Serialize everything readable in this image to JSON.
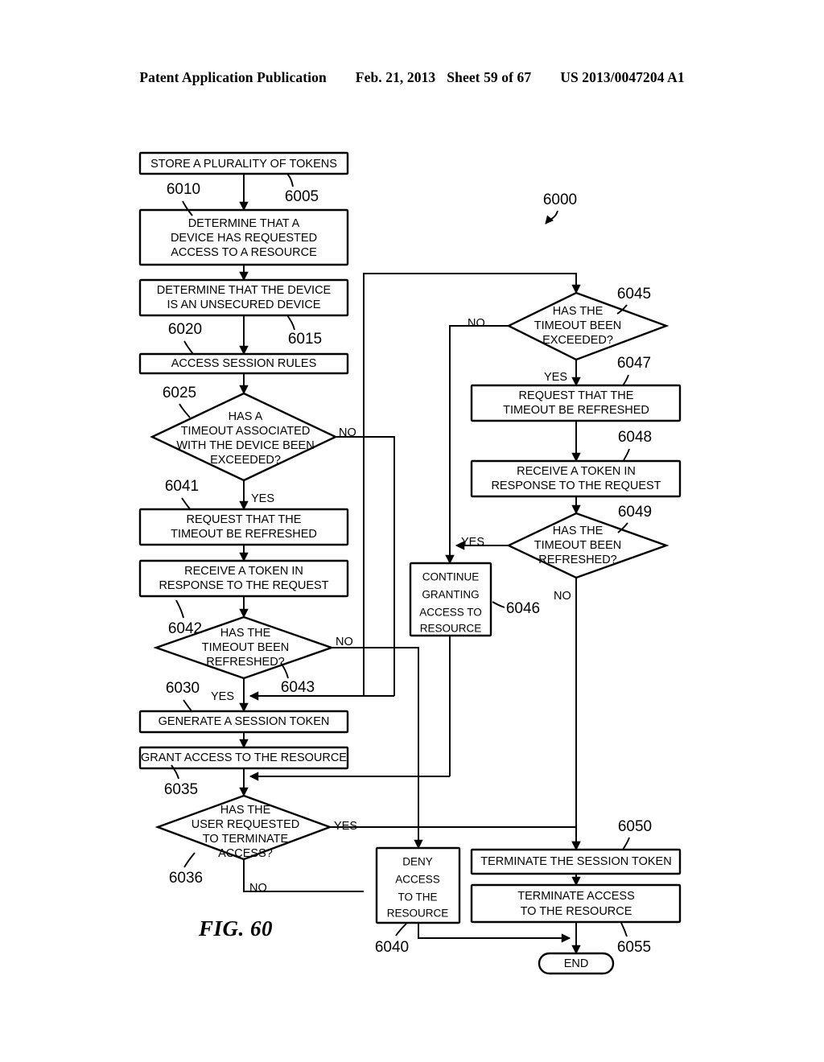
{
  "header": {
    "publication": "Patent Application Publication",
    "date": "Feb. 21, 2013",
    "sheet": "Sheet 59 of 67",
    "docnum": "US 2013/0047204 A1"
  },
  "figure": {
    "caption": "FIG. 60",
    "diagram_ref": "6000"
  },
  "flowchart": {
    "type": "flowchart",
    "nodes": [
      {
        "id": "6005",
        "ref": "6005",
        "shape": "process",
        "lines": [
          "STORE A PLURALITY OF TOKENS"
        ]
      },
      {
        "id": "6010",
        "ref": "6010",
        "shape": "process",
        "lines": [
          "DETERMINE THAT A",
          "DEVICE HAS REQUESTED",
          "ACCESS TO A RESOURCE"
        ]
      },
      {
        "id": "6015",
        "ref": "6015",
        "shape": "process",
        "lines": [
          "DETERMINE THAT THE DEVICE",
          "IS AN UNSECURED DEVICE"
        ]
      },
      {
        "id": "6020",
        "ref": "6020",
        "shape": "process",
        "lines": [
          "ACCESS SESSION RULES"
        ]
      },
      {
        "id": "6025",
        "ref": "6025",
        "shape": "decision",
        "lines": [
          "HAS A",
          "TIMEOUT ASSOCIATED",
          "WITH THE DEVICE BEEN",
          "EXCEEDED?"
        ]
      },
      {
        "id": "6041",
        "ref": "6041",
        "shape": "process",
        "lines": [
          "REQUEST THAT THE",
          "TIMEOUT BE REFRESHED"
        ]
      },
      {
        "id": "6042",
        "ref": "6042",
        "shape": "process",
        "lines": [
          "RECEIVE A TOKEN IN",
          "RESPONSE TO THE REQUEST"
        ]
      },
      {
        "id": "6043",
        "ref": "6043",
        "shape": "decision",
        "lines": [
          "HAS THE",
          "TIMEOUT BEEN",
          "REFRESHED?"
        ]
      },
      {
        "id": "6030",
        "ref": "6030",
        "shape": "process",
        "lines": [
          "GENERATE A SESSION TOKEN"
        ]
      },
      {
        "id": "6035",
        "ref": "6035",
        "shape": "process",
        "lines": [
          "GRANT ACCESS TO THE RESOURCE"
        ]
      },
      {
        "id": "6036",
        "ref": "6036",
        "shape": "decision",
        "lines": [
          "HAS THE",
          "USER REQUESTED",
          "TO TERMINATE",
          "ACCESS?"
        ]
      },
      {
        "id": "6045",
        "ref": "6045",
        "shape": "decision",
        "lines": [
          "HAS THE",
          "TIMEOUT BEEN",
          "EXCEEDED?"
        ]
      },
      {
        "id": "6047",
        "ref": "6047",
        "shape": "process",
        "lines": [
          "REQUEST THAT THE",
          "TIMEOUT BE REFRESHED"
        ]
      },
      {
        "id": "6048",
        "ref": "6048",
        "shape": "process",
        "lines": [
          "RECEIVE A TOKEN IN",
          "RESPONSE TO THE REQUEST"
        ]
      },
      {
        "id": "6049",
        "ref": "6049",
        "shape": "decision",
        "lines": [
          "HAS THE",
          "TIMEOUT BEEN",
          "REFRESHED?"
        ]
      },
      {
        "id": "6046",
        "ref": "6046",
        "shape": "process",
        "lines": [
          "CONTINUE",
          "GRANTING",
          "ACCESS TO",
          "RESOURCE"
        ]
      },
      {
        "id": "6040",
        "ref": "6040",
        "shape": "process",
        "lines": [
          "DENY",
          "ACCESS",
          "TO THE",
          "RESOURCE"
        ]
      },
      {
        "id": "6050",
        "ref": "6050",
        "shape": "process",
        "lines": [
          "TERMINATE THE SESSION TOKEN"
        ]
      },
      {
        "id": "6055",
        "ref": "6055",
        "shape": "process",
        "lines": [
          "TERMINATE ACCESS",
          "TO THE RESOURCE"
        ]
      },
      {
        "id": "end",
        "ref": "",
        "shape": "terminator",
        "lines": [
          "END"
        ]
      }
    ],
    "node_text": {
      "n6005_l1": "STORE A PLURALITY OF TOKENS",
      "n6010_l1": "DETERMINE THAT A",
      "n6010_l2": "DEVICE HAS REQUESTED",
      "n6010_l3": "ACCESS TO A RESOURCE",
      "n6015_l1": "DETERMINE THAT THE DEVICE",
      "n6015_l2": "IS AN UNSECURED DEVICE",
      "n6020_l1": "ACCESS SESSION RULES",
      "n6025_l1": "HAS A",
      "n6025_l2": "TIMEOUT ASSOCIATED",
      "n6025_l3": "WITH THE DEVICE BEEN",
      "n6025_l4": "EXCEEDED?",
      "n6041_l1": "REQUEST THAT THE",
      "n6041_l2": "TIMEOUT BE REFRESHED",
      "n6042_l1": "RECEIVE A TOKEN IN",
      "n6042_l2": "RESPONSE TO THE REQUEST",
      "n6043_l1": "HAS THE",
      "n6043_l2": "TIMEOUT BEEN",
      "n6043_l3": "REFRESHED?",
      "n6030_l1": "GENERATE A SESSION TOKEN",
      "n6035_l1": "GRANT ACCESS TO THE RESOURCE",
      "n6036_l1": "HAS THE",
      "n6036_l2": "USER REQUESTED",
      "n6036_l3": "TO TERMINATE",
      "n6036_l4": "ACCESS?",
      "n6045_l1": "HAS THE",
      "n6045_l2": "TIMEOUT BEEN",
      "n6045_l3": "EXCEEDED?",
      "n6047_l1": "REQUEST THAT THE",
      "n6047_l2": "TIMEOUT BE REFRESHED",
      "n6048_l1": "RECEIVE A TOKEN IN",
      "n6048_l2": "RESPONSE TO THE REQUEST",
      "n6049_l1": "HAS THE",
      "n6049_l2": "TIMEOUT BEEN",
      "n6049_l3": "REFRESHED?",
      "n6046_l1": "CONTINUE",
      "n6046_l2": "GRANTING",
      "n6046_l3": "ACCESS TO",
      "n6046_l4": "RESOURCE",
      "n6040_l1": "DENY",
      "n6040_l2": "ACCESS",
      "n6040_l3": "TO THE",
      "n6040_l4": "RESOURCE",
      "n6050_l1": "TERMINATE THE SESSION TOKEN",
      "n6055_l1": "TERMINATE ACCESS",
      "n6055_l2": "TO THE RESOURCE",
      "nend_l1": "END"
    },
    "ref_labels": {
      "r6000": "6000",
      "r6005": "6005",
      "r6010": "6010",
      "r6015": "6015",
      "r6020": "6020",
      "r6025": "6025",
      "r6030": "6030",
      "r6035": "6035",
      "r6036": "6036",
      "r6040": "6040",
      "r6041": "6041",
      "r6042": "6042",
      "r6043": "6043",
      "r6045": "6045",
      "r6046": "6046",
      "r6047": "6047",
      "r6048": "6048",
      "r6049": "6049",
      "r6050": "6050",
      "r6055": "6055"
    },
    "branch_labels": {
      "b6025_no": "NO",
      "b6025_yes": "YES",
      "b6043_no": "NO",
      "b6043_yes": "YES",
      "b6036_yes": "YES",
      "b6036_no": "NO",
      "b6045_no": "NO",
      "b6045_yes": "YES",
      "b6049_yes": "YES",
      "b6049_no": "NO"
    },
    "edges": [
      {
        "from": "6005",
        "to": "6010",
        "label": ""
      },
      {
        "from": "6010",
        "to": "6015",
        "label": ""
      },
      {
        "from": "6015",
        "to": "6020",
        "label": ""
      },
      {
        "from": "6020",
        "to": "6025",
        "label": ""
      },
      {
        "from": "6025",
        "to": "6041",
        "label": "YES"
      },
      {
        "from": "6025",
        "to": "6045",
        "label": "NO"
      },
      {
        "from": "6041",
        "to": "6042",
        "label": ""
      },
      {
        "from": "6042",
        "to": "6043",
        "label": ""
      },
      {
        "from": "6043",
        "to": "6030",
        "label": "YES"
      },
      {
        "from": "6043",
        "to": "6040",
        "label": "NO"
      },
      {
        "from": "6030",
        "to": "6035",
        "label": ""
      },
      {
        "from": "6035",
        "to": "6036",
        "label": ""
      },
      {
        "from": "6036",
        "to": "6050",
        "label": "YES"
      },
      {
        "from": "6036",
        "to": "6045",
        "label": "NO"
      },
      {
        "from": "6045",
        "to": "6047",
        "label": "YES"
      },
      {
        "from": "6045",
        "to": "6046",
        "label": "NO"
      },
      {
        "from": "6047",
        "to": "6048",
        "label": ""
      },
      {
        "from": "6048",
        "to": "6049",
        "label": ""
      },
      {
        "from": "6049",
        "to": "6046",
        "label": "YES"
      },
      {
        "from": "6049",
        "to": "6050",
        "label": "NO"
      },
      {
        "from": "6046",
        "to": "6035",
        "label": ""
      },
      {
        "from": "6040",
        "to": "end",
        "label": ""
      },
      {
        "from": "6050",
        "to": "6055",
        "label": ""
      },
      {
        "from": "6055",
        "to": "end",
        "label": ""
      }
    ]
  }
}
